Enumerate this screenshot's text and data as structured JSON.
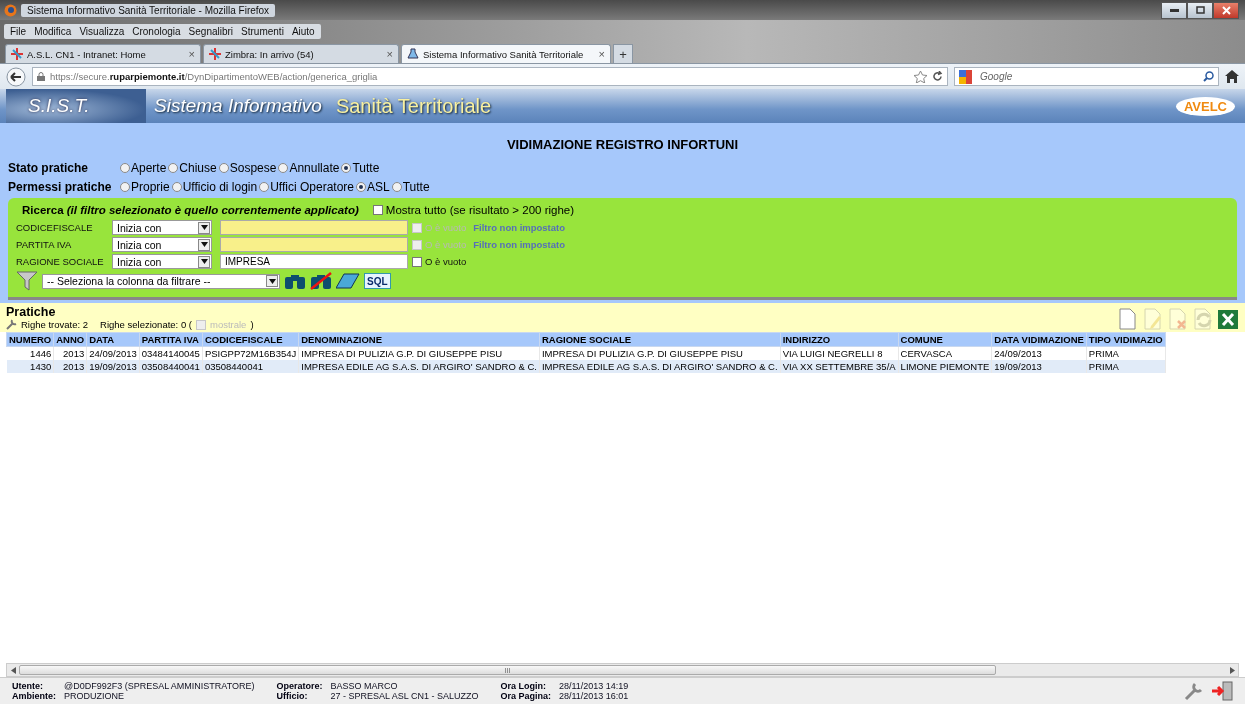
{
  "window": {
    "title": "Sistema Informativo Sanità Territoriale - Mozilla Firefox"
  },
  "menu": [
    "File",
    "Modifica",
    "Visualizza",
    "Cronologia",
    "Segnalibri",
    "Strumenti",
    "Aiuto"
  ],
  "tabs": [
    {
      "label": "A.S.L. CN1 - Intranet: Home",
      "selected": false,
      "close": "×"
    },
    {
      "label": "Zimbra: In arrivo (54)",
      "selected": false,
      "close": "×"
    },
    {
      "label": "Sistema Informativo Sanità Territoriale",
      "selected": true,
      "close": "×"
    }
  ],
  "new_tab": "+",
  "address": {
    "url": "https://secure.**ruparpiemonte.it**/DynDipartimentoWEB/action/generica_griglia",
    "search_placeholder": "Google"
  },
  "banner": {
    "logo": "S.I.S.T.",
    "subtitle": "Sistema Informativo",
    "title": "Sanità Territoriale",
    "partner_logo": "AVELC"
  },
  "page_title": "VIDIMAZIONE REGISTRO INFORTUNI",
  "radio_groups": [
    {
      "label": "Stato pratiche",
      "options": [
        {
          "label": "Aperte",
          "selected": false
        },
        {
          "label": "Chiuse",
          "selected": false
        },
        {
          "label": "Sospese",
          "selected": false
        },
        {
          "label": "Annullate",
          "selected": false
        },
        {
          "label": "Tutte",
          "selected": true
        }
      ]
    },
    {
      "label": "Permessi pratiche",
      "options": [
        {
          "label": "Proprie",
          "selected": false
        },
        {
          "label": "Ufficio di login",
          "selected": false
        },
        {
          "label": "Uffici Operatore",
          "selected": false
        },
        {
          "label": "ASL",
          "selected": true
        },
        {
          "label": "Tutte",
          "selected": false
        }
      ]
    }
  ],
  "search": {
    "title": "Ricerca *(il filtro selezionato è quello correntemente applicato)*",
    "show_all": {
      "label": "Mostra tutto (se risultato > 200 righe)",
      "checked": false
    },
    "filters": [
      {
        "field": "CODICEFISCALE",
        "operator": "Inizia con",
        "empty_label": "O è vuoto",
        "empty_checked": false,
        "disabled": true,
        "status": "Filtro non impostato"
      },
      {
        "field": "PARTITA IVA",
        "operator": "Inizia con",
        "empty_label": "O è vuoto",
        "empty_checked": false,
        "disabled": true,
        "status": "Filtro non impostato"
      },
      {
        "field": "RAGIONE SOCIALE",
        "operator": "Inizia con",
        "value": "IMPRESA",
        "empty_label": "O è vuoto",
        "empty_checked": false,
        "disabled": false
      }
    ],
    "column_select": "-- Seleziona la colonna da filtrare --",
    "sql_button": "SQL"
  },
  "results": {
    "title": "Pratiche",
    "found": "Righe trovate: 2",
    "selected_prefix": "Righe selezionate: 0 (",
    "show_selected": {
      "label": "mostrale",
      "checked": false,
      "disabled": true
    },
    "selected_suffix": ")",
    "actions": [
      {
        "kind": "new",
        "disabled": false
      },
      {
        "kind": "edit",
        "disabled": true
      },
      {
        "kind": "delete",
        "disabled": true
      },
      {
        "kind": "refresh",
        "disabled": true
      },
      {
        "kind": "excel",
        "disabled": false
      }
    ]
  },
  "table": {
    "columns": [
      "NUMERO",
      "ANNO",
      "DATA",
      "PARTITA IVA",
      "CODICEFISCALE",
      "DENOMINAZIONE",
      "RAGIONE SOCIALE",
      "INDIRIZZO",
      "COMUNE",
      "DATA VIDIMAZIONE",
      "TIPO VIDIMAZIO"
    ],
    "rows": [
      [
        "1446",
        "2013",
        "24/09/2013",
        "03484140045",
        "PSIGPP72M16B354J",
        "IMPRESA DI PULIZIA G.P. DI GIUSEPPE PISU",
        "IMPRESA DI PULIZIA G.P. DI GIUSEPPE PISU",
        "VIA LUIGI NEGRELLI 8",
        "CERVASCA",
        "24/09/2013",
        "PRIMA"
      ],
      [
        "1430",
        "2013",
        "19/09/2013",
        "03508440041",
        "03508440041",
        "IMPRESA EDILE AG S.A.S. DI ARGIRO' SANDRO & C.",
        "IMPRESA EDILE AG S.A.S. DI ARGIRO' SANDRO & C.",
        "VIA XX SETTEMBRE 35/A",
        "LIMONE PIEMONTE",
        "19/09/2013",
        "PRIMA"
      ]
    ]
  },
  "scrollbar_grip": "III",
  "status_bar": [
    [
      {
        "label": "Utente:",
        "value": "@D0DF992F3 (SPRESAL AMMINISTRATORE)"
      },
      {
        "label": "Ambiente:",
        "value": "PRODUZIONE"
      }
    ],
    [
      {
        "label": "Operatore:",
        "value": "BASSO MARCO"
      },
      {
        "label": "Ufficio:",
        "value": "27 - SPRESAL ASL CN1 - SALUZZO"
      }
    ],
    [
      {
        "label": "Ora Login:",
        "value": "28/11/2013 14:19"
      },
      {
        "label": "Ora Pagina:",
        "value": "28/11/2013 16:01"
      }
    ]
  ]
}
